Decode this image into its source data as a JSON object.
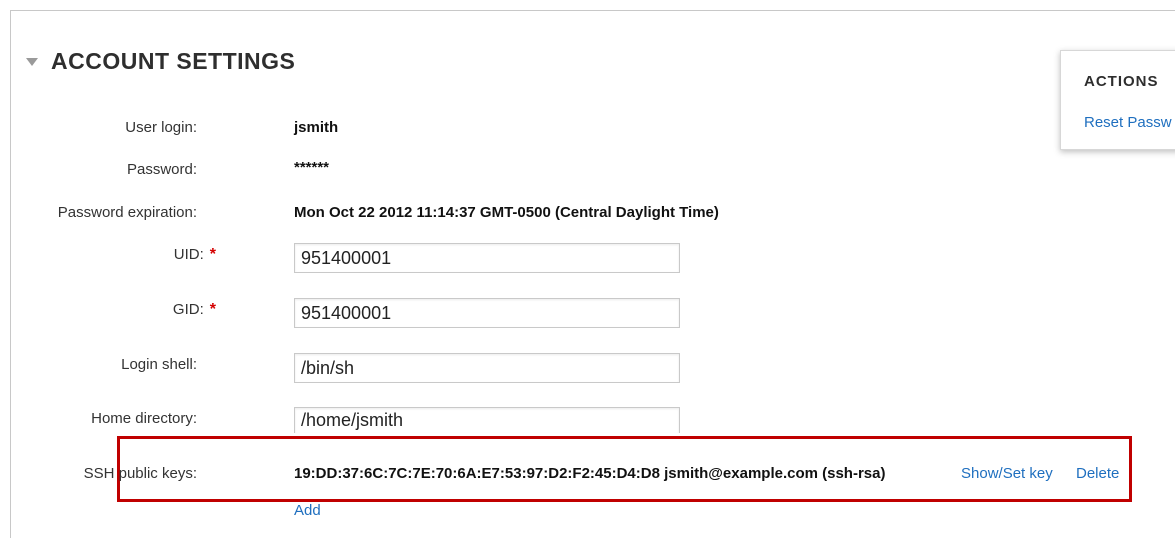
{
  "section": {
    "title": "ACCOUNT SETTINGS"
  },
  "fields": {
    "user_login": {
      "label": "User login:",
      "value": "jsmith"
    },
    "password": {
      "label": "Password:",
      "value": "******"
    },
    "password_expiration": {
      "label": "Password expiration:",
      "value": "Mon Oct 22 2012 11:14:37 GMT-0500 (Central Daylight Time)"
    },
    "uid": {
      "label": "UID:",
      "value": "951400001",
      "required_mark": "*"
    },
    "gid": {
      "label": "GID:",
      "value": "951400001",
      "required_mark": "*"
    },
    "login_shell": {
      "label": "Login shell:",
      "value": "/bin/sh"
    },
    "home_directory": {
      "label": "Home directory:",
      "value": "/home/jsmith"
    },
    "ssh_public_keys": {
      "label": "SSH public keys:",
      "value": "19:DD:37:6C:7C:7E:70:6A:E7:53:97:D2:F2:45:D4:D8 jsmith@example.com (ssh-rsa)",
      "show_set_key": "Show/Set key",
      "delete": "Delete",
      "add": "Add"
    }
  },
  "actions": {
    "title": "ACTIONS",
    "reset_password": "Reset Passw"
  },
  "colors": {
    "link": "#1f6fbf",
    "required": "#d40000",
    "highlight_border": "#c00000"
  }
}
